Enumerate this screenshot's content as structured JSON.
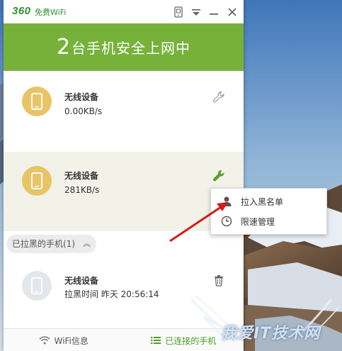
{
  "app": {
    "logo_num": "360",
    "logo_text": "免费WiFi",
    "banner_count": "2",
    "banner_text": "台手机安全上网中"
  },
  "devices": [
    {
      "name": "无线设备",
      "speed": "0.00KB/s",
      "icon": "wrench-icon",
      "selected": false
    },
    {
      "name": "无线设备",
      "speed": "281KB/s",
      "icon": "wrench-icon",
      "selected": true
    }
  ],
  "blacklist": {
    "header": "已拉黑的手机(1)",
    "chevron": "︽",
    "items": [
      {
        "name": "无线设备",
        "time": "拉黑时间 昨天 20:56:14",
        "icon": "trash-icon"
      }
    ]
  },
  "context_menu": {
    "items": [
      {
        "label": "拉入黑名单",
        "icon": "user-icon"
      },
      {
        "label": "限速管理",
        "icon": "clock-icon"
      }
    ]
  },
  "tabs": [
    {
      "label": "WiFi信息",
      "icon": "wifi-icon"
    },
    {
      "label": "已连接的手机",
      "icon": "list-icon"
    }
  ],
  "colors": {
    "brand_green": "#76b23a",
    "tab_active": "#4f9c28",
    "avatar_active": "#e8c465",
    "arrow_red": "#d21c1c"
  },
  "watermark": {
    "text": "我爱IT技术网"
  }
}
